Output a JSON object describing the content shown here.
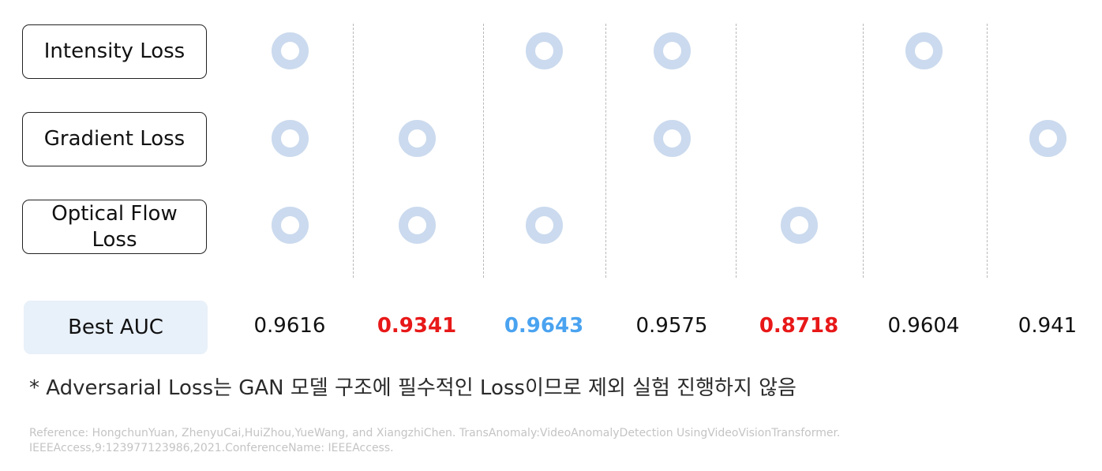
{
  "rows": [
    {
      "label": "Intensity Loss",
      "marks": [
        true,
        false,
        true,
        true,
        false,
        true,
        false
      ]
    },
    {
      "label": "Gradient Loss",
      "marks": [
        true,
        true,
        false,
        true,
        false,
        false,
        true
      ]
    },
    {
      "label": "Optical Flow Loss",
      "marks": [
        true,
        true,
        true,
        false,
        true,
        false,
        false
      ]
    }
  ],
  "auc": {
    "label": "Best AUC",
    "values": [
      "0.9616",
      "0.9341",
      "0.9643",
      "0.9575",
      "0.8718",
      "0.9604",
      "0.941"
    ],
    "highlight": [
      "normal",
      "worst",
      "best",
      "normal",
      "worst",
      "normal",
      "normal"
    ]
  },
  "colors": {
    "ring": "#cbdaee",
    "worst": "#e81818",
    "best": "#4aa3f0",
    "auc_box_bg": "#e8f0f9"
  },
  "icons": {
    "mark": "ring-icon"
  },
  "note": "* Adversarial Loss는 GAN 모델 구조에 필수적인 Loss이므로 제외 실험 진행하지 않음",
  "reference": {
    "line1": "Reference: HongchunYuan, ZhenyuCai,HuiZhou,YueWang, and XiangzhiChen. TransAnomaly:VideoAnomalyDetection UsingVideoVisionTransformer.",
    "line2": "IEEEAccess,9:123977123986,2021.ConferenceName: IEEEAccess."
  }
}
